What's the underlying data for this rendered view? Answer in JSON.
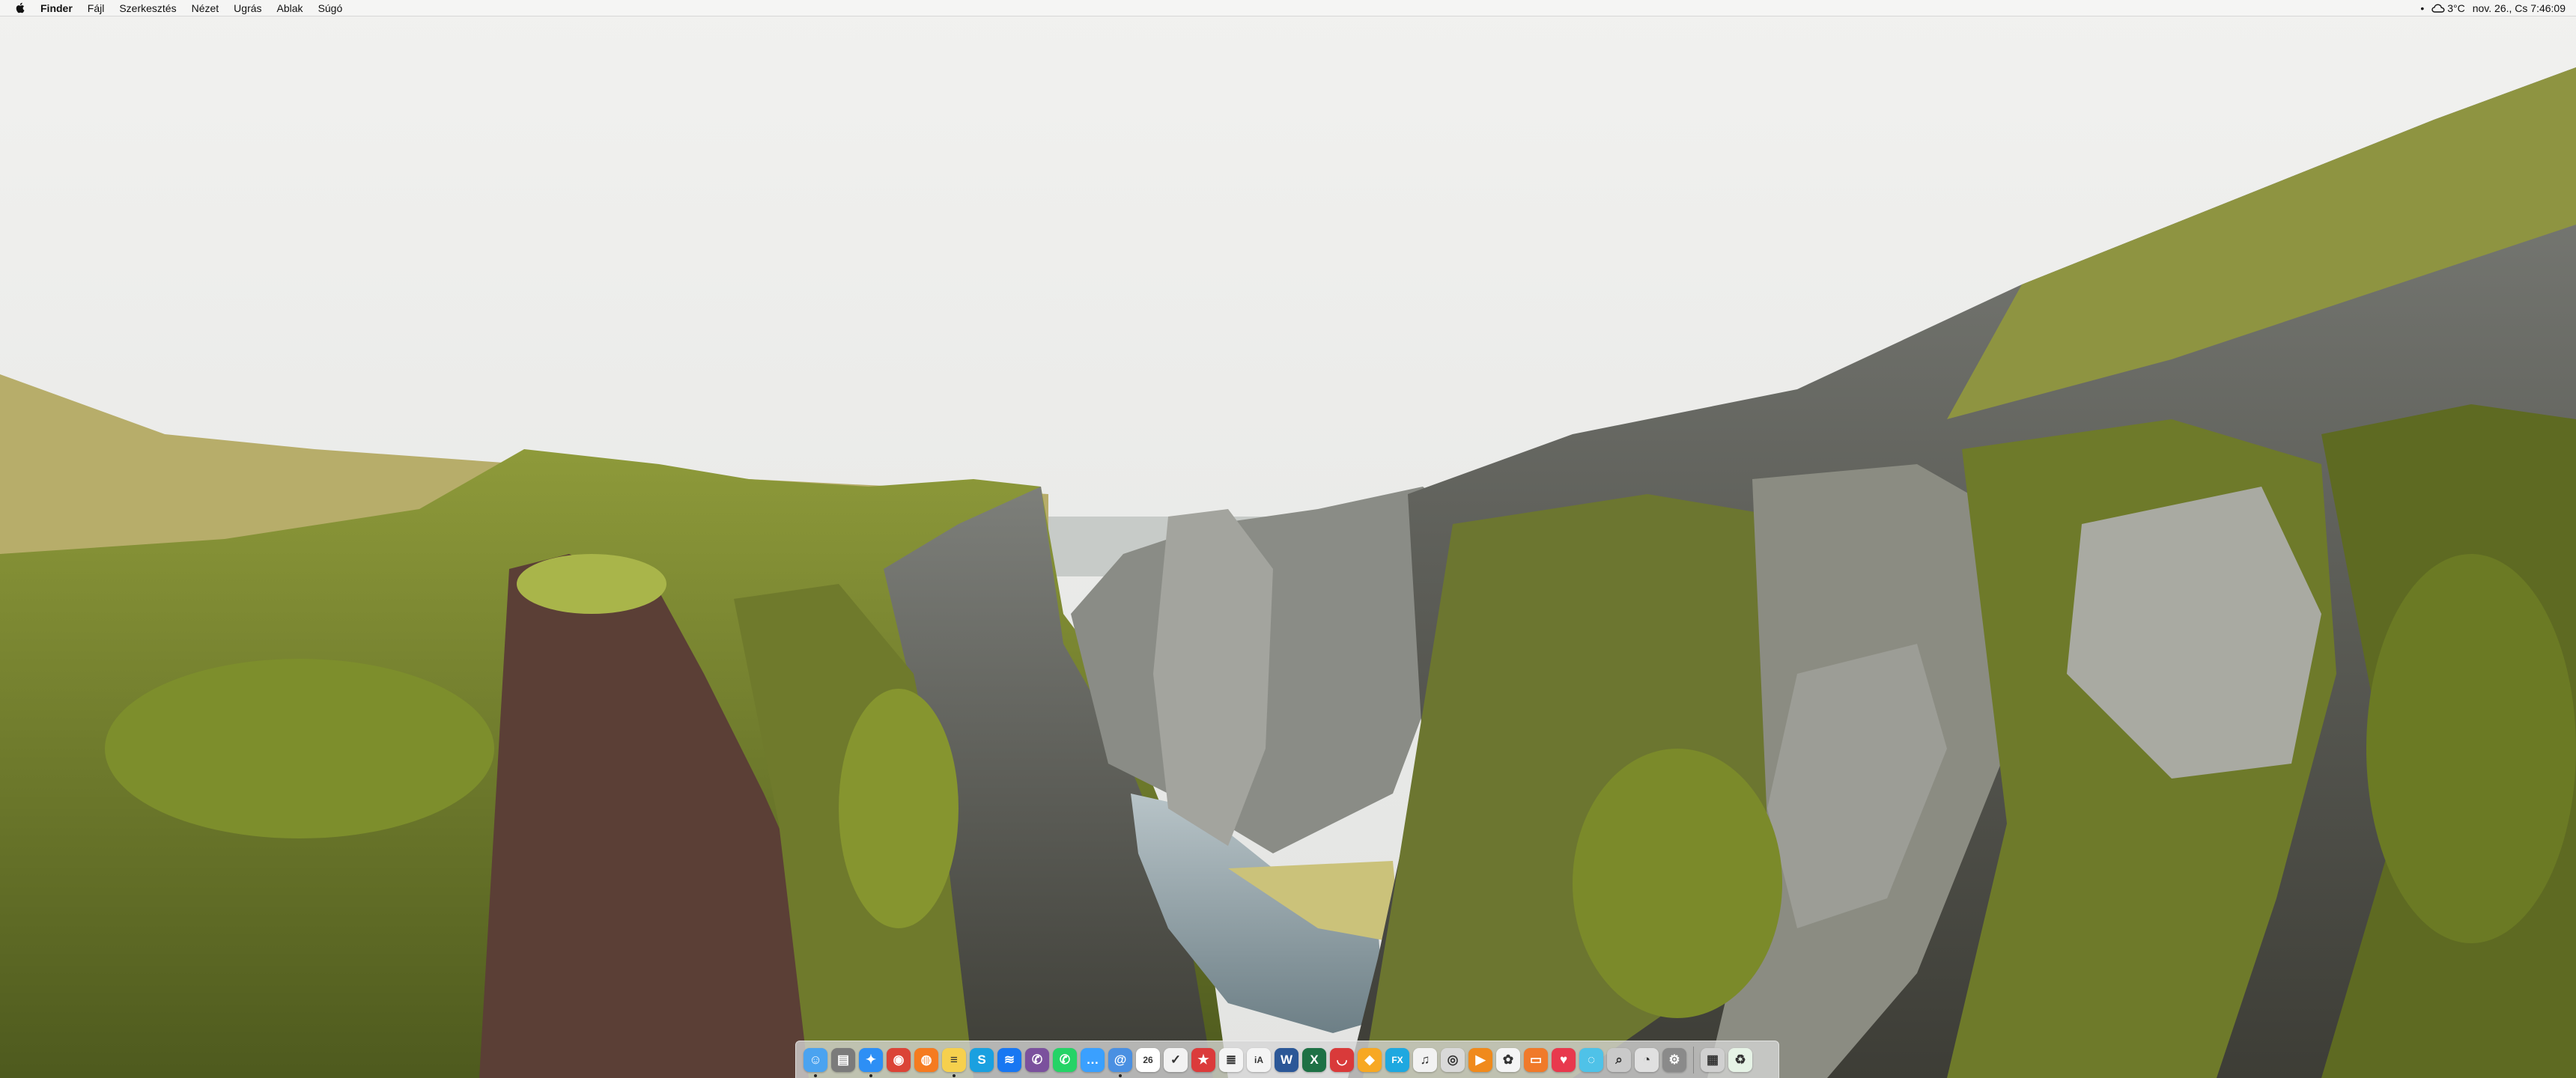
{
  "menubar": {
    "apple_icon": "apple-icon",
    "app_name": "Finder",
    "items": [
      "Fájl",
      "Szerkesztés",
      "Nézet",
      "Ugrás",
      "Ablak",
      "Súgó"
    ],
    "status": {
      "dot": "•",
      "weather_icon": "cloud-icon",
      "temperature": "3°C",
      "datetime": "nov. 26., Cs  7:46:09"
    }
  },
  "wallpaper": {
    "subject": "mossy canyon landscape"
  },
  "dock": {
    "items": [
      {
        "name": "finder",
        "icon": "finder-icon",
        "glyph": "☺",
        "color": "#4aa3f0",
        "running": true
      },
      {
        "name": "disk-utility",
        "icon": "disk-icon",
        "glyph": "▤",
        "color": "#7b7b7b",
        "running": false
      },
      {
        "name": "safari",
        "icon": "compass-icon",
        "glyph": "✦",
        "color": "#2d8ff5",
        "running": true
      },
      {
        "name": "chrome",
        "icon": "chrome-icon",
        "glyph": "◉",
        "color": "#db4437",
        "running": false
      },
      {
        "name": "firefox",
        "icon": "firefox-icon",
        "glyph": "◍",
        "color": "#f57b20",
        "running": false
      },
      {
        "name": "notes",
        "icon": "notes-icon",
        "glyph": "≡",
        "color": "#f6d04d",
        "running": true
      },
      {
        "name": "skype",
        "icon": "skype-icon",
        "glyph": "S",
        "color": "#1aa0e0",
        "running": false
      },
      {
        "name": "messenger",
        "icon": "messenger-icon",
        "glyph": "≋",
        "color": "#1877f2",
        "running": false
      },
      {
        "name": "viber",
        "icon": "viber-icon",
        "glyph": "✆",
        "color": "#7b519d",
        "running": false
      },
      {
        "name": "whatsapp",
        "icon": "whatsapp-icon",
        "glyph": "✆",
        "color": "#25d366",
        "running": false
      },
      {
        "name": "messages",
        "icon": "messages-icon",
        "glyph": "…",
        "color": "#3aa0ff",
        "running": false
      },
      {
        "name": "mail",
        "icon": "mail-icon",
        "glyph": "@",
        "color": "#4a90e2",
        "running": true
      },
      {
        "name": "calendar",
        "icon": "calendar-icon",
        "glyph": "26",
        "color": "#ffffff",
        "running": false
      },
      {
        "name": "reminders",
        "icon": "checkmark-icon",
        "glyph": "✓",
        "color": "#f2f2f2",
        "running": false
      },
      {
        "name": "wunderlist",
        "icon": "star-icon",
        "glyph": "★",
        "color": "#db3b3b",
        "running": false
      },
      {
        "name": "textedit",
        "icon": "text-icon",
        "glyph": "≣",
        "color": "#f4f4f4",
        "running": false
      },
      {
        "name": "ia-writer",
        "icon": "ia-icon",
        "glyph": "iA",
        "color": "#f4f4f4",
        "running": false
      },
      {
        "name": "word",
        "icon": "word-icon",
        "glyph": "W",
        "color": "#2b5797",
        "running": false
      },
      {
        "name": "excel",
        "icon": "excel-icon",
        "glyph": "X",
        "color": "#1e7145",
        "running": false
      },
      {
        "name": "speech",
        "icon": "lips-icon",
        "glyph": "◡",
        "color": "#d93a3a",
        "running": false
      },
      {
        "name": "sketch",
        "icon": "diamond-icon",
        "glyph": "◆",
        "color": "#f7a823",
        "running": false
      },
      {
        "name": "fx",
        "icon": "fx-icon",
        "glyph": "FX",
        "color": "#1ea8e0",
        "running": false
      },
      {
        "name": "music",
        "icon": "music-note-icon",
        "glyph": "♫",
        "color": "#f2f2f2",
        "running": false
      },
      {
        "name": "podcasts",
        "icon": "broadcast-icon",
        "glyph": "◎",
        "color": "#d9d9d9",
        "running": false
      },
      {
        "name": "infuse",
        "icon": "play-icon",
        "glyph": "▶",
        "color": "#f08a1c",
        "running": false
      },
      {
        "name": "photos",
        "icon": "photos-icon",
        "glyph": "✿",
        "color": "#f5f5f5",
        "running": false
      },
      {
        "name": "books",
        "icon": "book-icon",
        "glyph": "▭",
        "color": "#f07a2a",
        "running": false
      },
      {
        "name": "pocket",
        "icon": "pocket-icon",
        "glyph": "♥",
        "color": "#e8394d",
        "running": false
      },
      {
        "name": "vpn",
        "icon": "globe-icon",
        "glyph": "◌",
        "color": "#4fc2e8",
        "running": false
      },
      {
        "name": "preview",
        "icon": "magnifier-icon",
        "glyph": "⌕",
        "color": "#c9c9c9",
        "running": false
      },
      {
        "name": "disk-clock",
        "icon": "clock-icon",
        "glyph": "◔",
        "color": "#e0e0e0",
        "running": false
      },
      {
        "name": "system-preferences",
        "icon": "gear-icon",
        "glyph": "⚙",
        "color": "#8a8a8a",
        "running": false
      }
    ],
    "trailing_items": [
      {
        "name": "documents-stack",
        "icon": "folder-icon",
        "glyph": "▦",
        "color": "#d0d0d0",
        "running": false
      },
      {
        "name": "trash",
        "icon": "recycle-icon",
        "glyph": "♻",
        "color": "#e6f3e6",
        "running": false
      }
    ]
  }
}
